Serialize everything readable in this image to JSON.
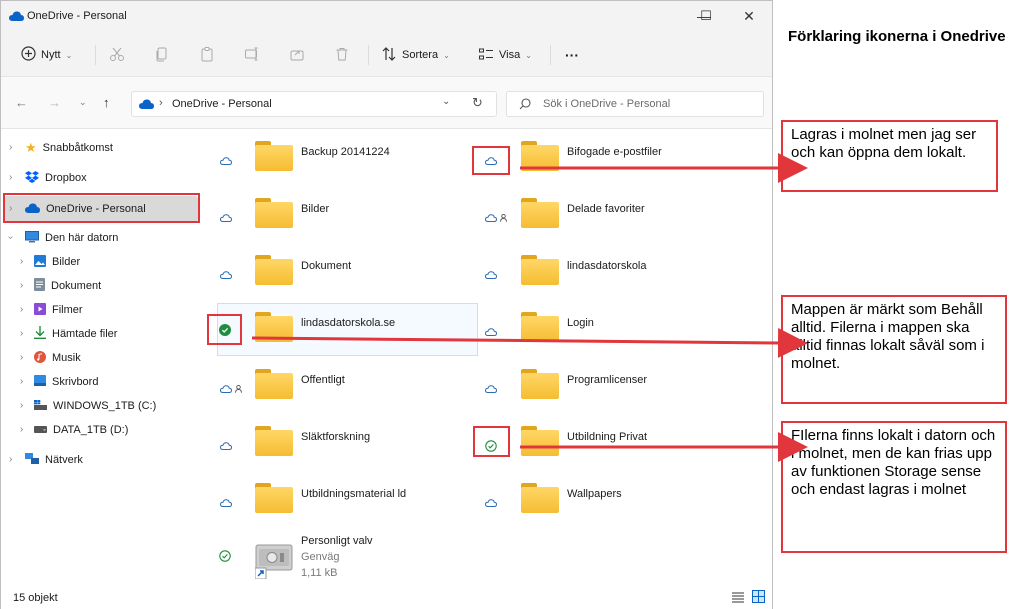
{
  "window": {
    "title": "OneDrive - Personal",
    "controls": {
      "minimize": "—",
      "maximize": "☐",
      "close": "✕"
    }
  },
  "toolbar": {
    "new_label": "Nytt",
    "sort_label": "Sortera",
    "view_label": "Visa",
    "more_label": "···"
  },
  "address": {
    "path": "OneDrive - Personal",
    "search_placeholder": "Sök i OneDrive - Personal"
  },
  "sidebar": {
    "items": [
      {
        "label": "Snabbåtkomst"
      },
      {
        "label": "Dropbox"
      },
      {
        "label": "OneDrive - Personal"
      },
      {
        "label": "Den här datorn"
      },
      {
        "label": "Bilder"
      },
      {
        "label": "Dokument"
      },
      {
        "label": "Filmer"
      },
      {
        "label": "Hämtade filer"
      },
      {
        "label": "Musik"
      },
      {
        "label": "Skrivbord"
      },
      {
        "label": "WINDOWS_1TB (C:)"
      },
      {
        "label": "DATA_1TB (D:)"
      },
      {
        "label": "Nätverk"
      }
    ]
  },
  "folders": [
    {
      "name": "Backup 20141224",
      "status": "cloud"
    },
    {
      "name": "Bifogade e-postfiler",
      "status": "cloud"
    },
    {
      "name": "Bilder",
      "status": "cloud"
    },
    {
      "name": "Delade favoriter",
      "status": "cloud-shared"
    },
    {
      "name": "Dokument",
      "status": "cloud"
    },
    {
      "name": "lindasdatorskola",
      "status": "cloud"
    },
    {
      "name": "lindasdatorskola.se",
      "status": "always-keep"
    },
    {
      "name": "Login",
      "status": "cloud"
    },
    {
      "name": "Offentligt",
      "status": "cloud-shared"
    },
    {
      "name": "Programlicenser",
      "status": "cloud"
    },
    {
      "name": "Släktforskning",
      "status": "cloud"
    },
    {
      "name": "Utbildning Privat",
      "status": "local"
    },
    {
      "name": "Utbildningsmaterial ld",
      "status": "cloud"
    },
    {
      "name": "Wallpapers",
      "status": "cloud"
    }
  ],
  "vault": {
    "name": "Personligt valv",
    "type": "Genväg",
    "size": "1,11 kB",
    "status": "local"
  },
  "statusbar": {
    "count": "15 objekt"
  },
  "annotations": {
    "heading": "Förklaring ikonerna i Onedrive",
    "callout_cloud": "Lagras i molnet men jag ser och kan öppna dem lokalt.",
    "callout_always": "Mappen är märkt som Behåll alltid. Filerna i mappen ska alltid finnas lokalt såväl som i molnet.",
    "callout_local": "FIlerna finns lokalt i datorn och i molnet, men de kan frias upp av funktionen Storage sense och endast lagras i molnet"
  },
  "colors": {
    "accent": "#0a64c8",
    "annotation": "#e0363c",
    "folder": "#f5bd32",
    "synced": "#1e8e3e"
  }
}
